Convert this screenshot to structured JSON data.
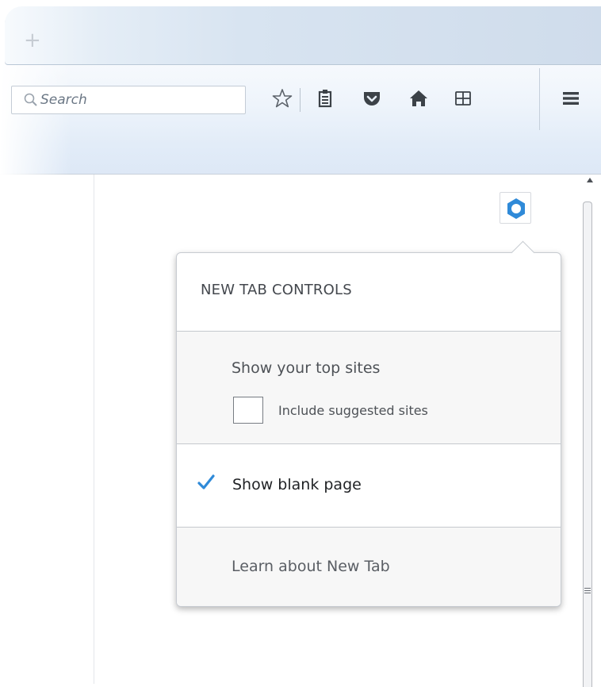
{
  "tabstrip": {
    "newtab_label": "+"
  },
  "search": {
    "placeholder": "Search",
    "value": ""
  },
  "toolbar": {
    "icons": [
      "bookmark-star-icon",
      "reading-list-icon",
      "pocket-icon",
      "home-icon",
      "windows-icon",
      "hamburger-menu-icon"
    ]
  },
  "newtab_panel": {
    "title": "NEW TAB CONTROLS",
    "show_top_sites_label": "Show your top sites",
    "include_suggested_label": "Include suggested sites",
    "include_suggested_checked": false,
    "show_blank_label": "Show blank page",
    "show_blank_selected": true,
    "learn_more_label": "Learn about New Tab"
  },
  "colors": {
    "accent_blue": "#2f8ad8",
    "toolbar_icon": "#3c4248",
    "panel_section_bg": "#f7f7f7"
  }
}
